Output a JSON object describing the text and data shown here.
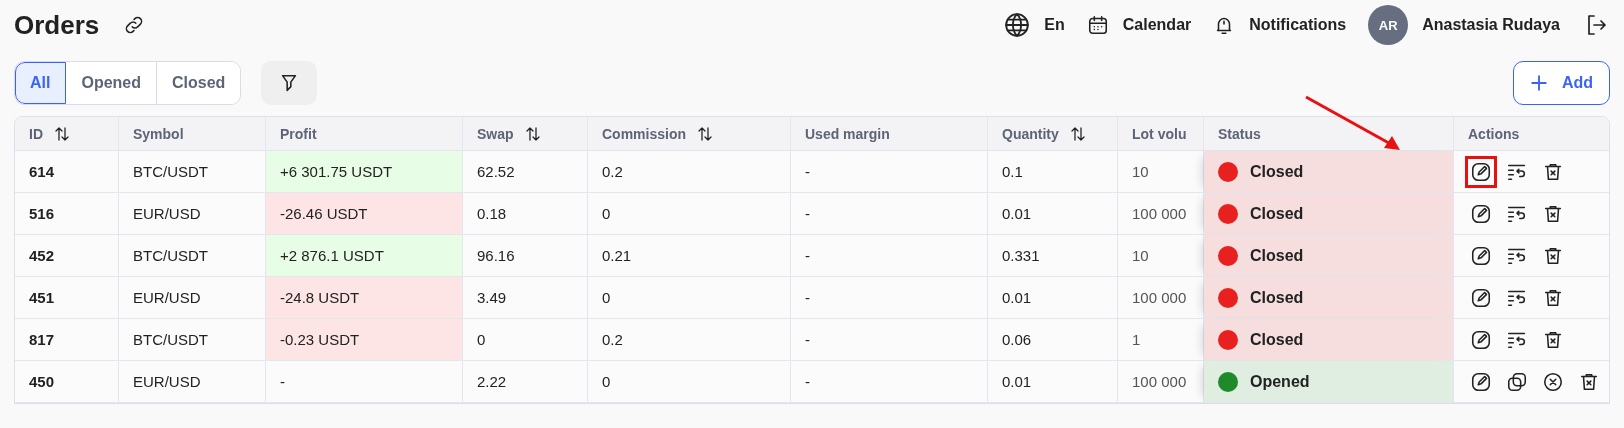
{
  "header": {
    "title": "Orders",
    "language": "En",
    "calendar": "Calendar",
    "notifications": "Notifications",
    "user": {
      "initials": "AR",
      "name": "Anastasia Rudaya"
    }
  },
  "filters": [
    {
      "label": "All",
      "selected": true
    },
    {
      "label": "Opened",
      "selected": false
    },
    {
      "label": "Closed",
      "selected": false
    }
  ],
  "add_button": "Add",
  "table": {
    "columns": [
      {
        "label": "ID",
        "sortable": true
      },
      {
        "label": "Symbol",
        "sortable": false
      },
      {
        "label": "Profit",
        "sortable": false
      },
      {
        "label": "Swap",
        "sortable": true
      },
      {
        "label": "Commission",
        "sortable": true
      },
      {
        "label": "Used margin",
        "sortable": false
      },
      {
        "label": "Quantity",
        "sortable": true
      },
      {
        "label": "Lot volu"
      },
      {
        "label": "Status",
        "sortable": false
      },
      {
        "label": "Actions",
        "sortable": false
      }
    ],
    "rows": [
      {
        "id": "614",
        "symbol": "BTC/USDT",
        "profit": {
          "text": "+6 301.75 USDT",
          "kind": "gain"
        },
        "swap": "62.52",
        "commission": "0.2",
        "used_margin": "-",
        "quantity": "0.1",
        "lot_volume": "10",
        "status": {
          "text": "Closed",
          "kind": "closed",
          "color": "#e8201f"
        },
        "actions": [
          {
            "kind": "edit",
            "highlighted": true
          },
          {
            "kind": "reverse"
          },
          {
            "kind": "delete"
          }
        ]
      },
      {
        "id": "516",
        "symbol": "EUR/USD",
        "profit": {
          "text": "-26.46 USDT",
          "kind": "loss"
        },
        "swap": "0.18",
        "commission": "0",
        "used_margin": "-",
        "quantity": "0.01",
        "lot_volume": "100 000",
        "status": {
          "text": "Closed",
          "kind": "closed",
          "color": "#e8201f"
        },
        "actions": [
          {
            "kind": "edit",
            "highlighted": false
          },
          {
            "kind": "reverse"
          },
          {
            "kind": "delete"
          }
        ]
      },
      {
        "id": "452",
        "symbol": "BTC/USDT",
        "profit": {
          "text": "+2 876.1 USDT",
          "kind": "gain"
        },
        "swap": "96.16",
        "commission": "0.21",
        "used_margin": "-",
        "quantity": "0.331",
        "lot_volume": "10",
        "status": {
          "text": "Closed",
          "kind": "closed",
          "color": "#e8201f"
        },
        "actions": [
          {
            "kind": "edit",
            "highlighted": false
          },
          {
            "kind": "reverse"
          },
          {
            "kind": "delete"
          }
        ]
      },
      {
        "id": "451",
        "symbol": "EUR/USD",
        "profit": {
          "text": "-24.8 USDT",
          "kind": "loss"
        },
        "swap": "3.49",
        "commission": "0",
        "used_margin": "-",
        "quantity": "0.01",
        "lot_volume": "100 000",
        "status": {
          "text": "Closed",
          "kind": "closed",
          "color": "#e8201f"
        },
        "actions": [
          {
            "kind": "edit",
            "highlighted": false
          },
          {
            "kind": "reverse"
          },
          {
            "kind": "delete"
          }
        ]
      },
      {
        "id": "817",
        "symbol": "BTC/USDT",
        "profit": {
          "text": "-0.23 USDT",
          "kind": "loss"
        },
        "swap": "0",
        "commission": "0.2",
        "used_margin": "-",
        "quantity": "0.06",
        "lot_volume": "1",
        "status": {
          "text": "Closed",
          "kind": "closed",
          "color": "#e8201f"
        },
        "actions": [
          {
            "kind": "edit",
            "highlighted": false
          },
          {
            "kind": "reverse"
          },
          {
            "kind": "delete"
          }
        ]
      },
      {
        "id": "450",
        "symbol": "EUR/USD",
        "profit": {
          "text": "-",
          "kind": "none"
        },
        "swap": "2.22",
        "commission": "0",
        "used_margin": "-",
        "quantity": "0.01",
        "lot_volume": "100 000",
        "status": {
          "text": "Opened",
          "kind": "opened",
          "color": "#1e8a2a"
        },
        "actions": [
          {
            "kind": "edit",
            "highlighted": false
          },
          {
            "kind": "duplicate"
          },
          {
            "kind": "cancel"
          },
          {
            "kind": "delete"
          }
        ]
      }
    ]
  }
}
